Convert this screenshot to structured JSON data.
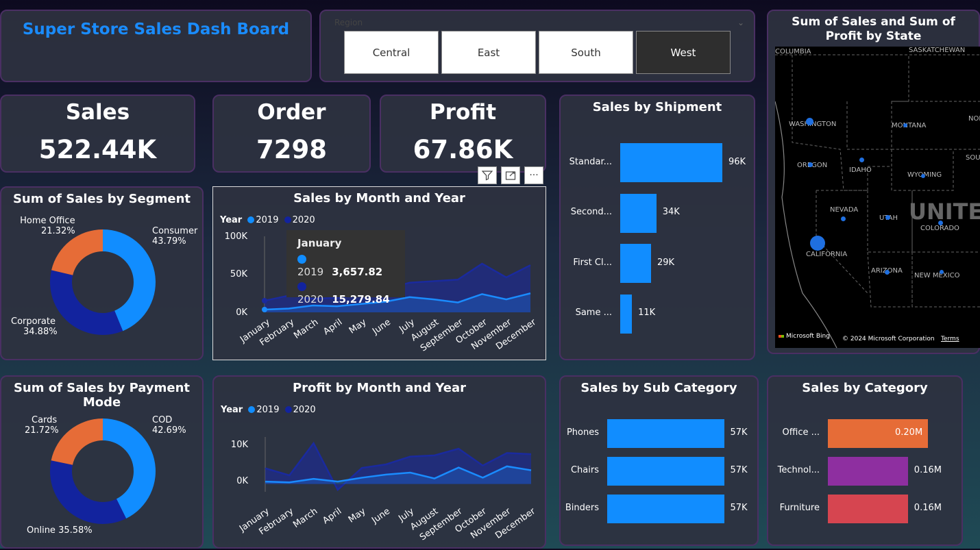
{
  "header": {
    "title": "Super Store Sales Dash Board"
  },
  "slicer": {
    "title": "Region",
    "options": [
      "Central",
      "East",
      "South",
      "West"
    ],
    "selected": "West"
  },
  "kpis": {
    "sales": {
      "label": "Sales",
      "value": "522.44K"
    },
    "order": {
      "label": "Order",
      "value": "7298"
    },
    "profit": {
      "label": "Profit",
      "value": "67.86K"
    }
  },
  "colors": {
    "accent": "#118dff",
    "dark_blue": "#12239e",
    "orange": "#e66c37",
    "purple": "#6b007b",
    "red": "#d64550",
    "title_blue": "#1a8cff"
  },
  "segment": {
    "title": "Sum of Sales by Segment",
    "slices": [
      {
        "name": "Consumer",
        "pct": "43.79%",
        "value": 43.79,
        "color": "#118dff"
      },
      {
        "name": "Corporate",
        "pct": "34.88%",
        "value": 34.88,
        "color": "#12239e"
      },
      {
        "name": "Home Office",
        "pct": "21.32%",
        "value": 21.32,
        "color": "#e66c37"
      }
    ]
  },
  "payment": {
    "title": "Sum of Sales by Payment Mode",
    "slices": [
      {
        "name": "COD",
        "pct": "42.69%",
        "value": 42.69,
        "color": "#118dff"
      },
      {
        "name": "Online",
        "pct": "35.58%",
        "value": 35.58,
        "color": "#12239e"
      },
      {
        "name": "Cards",
        "pct": "21.72%",
        "value": 21.72,
        "color": "#e66c37"
      }
    ]
  },
  "sales_month": {
    "title": "Sales by Month and Year",
    "legend_title": "Year",
    "series_names": [
      "2019",
      "2020"
    ],
    "yticks": [
      "100K",
      "50K",
      "0K"
    ],
    "tooltip": {
      "title": "January",
      "rows": [
        {
          "year": "2019",
          "value": "3,657.82"
        },
        {
          "year": "2020",
          "value": "15,279.84"
        }
      ]
    }
  },
  "profit_month": {
    "title": "Profit by Month and Year",
    "legend_title": "Year",
    "series_names": [
      "2019",
      "2020"
    ],
    "yticks": [
      "10K",
      "0K"
    ]
  },
  "months": [
    "January",
    "February",
    "March",
    "April",
    "May",
    "June",
    "July",
    "August",
    "September",
    "October",
    "November",
    "December"
  ],
  "chart_data": [
    {
      "type": "area",
      "title": "Sales by Month and Year",
      "x": [
        "January",
        "February",
        "March",
        "April",
        "May",
        "June",
        "July",
        "August",
        "September",
        "October",
        "November",
        "December"
      ],
      "ylim": [
        0,
        100000
      ],
      "series": [
        {
          "name": "2019",
          "values": [
            3658,
            5000,
            9000,
            8000,
            11000,
            14000,
            20000,
            17000,
            13000,
            24000,
            17000,
            25000
          ]
        },
        {
          "name": "2020",
          "values": [
            15280,
            22000,
            18000,
            19000,
            23000,
            30000,
            39000,
            41000,
            43000,
            64000,
            46000,
            62000
          ]
        }
      ]
    },
    {
      "type": "area",
      "title": "Profit by Month and Year",
      "x": [
        "January",
        "February",
        "March",
        "April",
        "May",
        "June",
        "July",
        "August",
        "September",
        "October",
        "November",
        "December"
      ],
      "ylim": [
        -2000,
        12000
      ],
      "series": [
        {
          "name": "2019",
          "values": [
            600,
            400,
            1300,
            600,
            1600,
            2400,
            2900,
            1400,
            4200,
            1600,
            4500,
            3500
          ]
        },
        {
          "name": "2020",
          "values": [
            4000,
            2200,
            10400,
            -1500,
            4100,
            5000,
            7000,
            7300,
            9000,
            4700,
            7900,
            7600
          ]
        }
      ]
    },
    {
      "type": "bar",
      "title": "Sales by Shipment",
      "categories": [
        "Standar...",
        "Second...",
        "First Cl...",
        "Same ..."
      ],
      "values": [
        96,
        34,
        29,
        11
      ],
      "labels": [
        "96K",
        "34K",
        "29K",
        "11K"
      ]
    },
    {
      "type": "bar",
      "title": "Sales by Sub Category",
      "categories": [
        "Phones",
        "Chairs",
        "Binders"
      ],
      "values": [
        57,
        57,
        57
      ],
      "labels": [
        "57K",
        "57K",
        "57K"
      ]
    },
    {
      "type": "bar",
      "title": "Sales by Category",
      "categories": [
        "Office ...",
        "Technol...",
        "Furniture"
      ],
      "values": [
        0.2,
        0.16,
        0.16
      ],
      "labels": [
        "0.20M",
        "0.16M",
        "0.16M"
      ]
    }
  ],
  "shipment": {
    "title": "Sales by Shipment"
  },
  "subcat": {
    "title": "Sales by Sub Category"
  },
  "category": {
    "title": "Sales by Category"
  },
  "map": {
    "title": "Sum of Sales and Sum of Profit by State",
    "labels": [
      "COLUMBIA",
      "SASKATCHEWAN",
      "WASHINGTON",
      "MONTANA",
      "NORT",
      "OREGON",
      "IDAHO",
      "WYOMING",
      "SOUT",
      "NEVADA",
      "UTAH",
      "UNITE",
      "COLORADO",
      "CALIFORNIA",
      "ARIZONA",
      "NEW MEXICO"
    ],
    "attribution": "Microsoft Bing",
    "copyright": "© 2024 Microsoft Corporation",
    "terms": "Terms"
  }
}
